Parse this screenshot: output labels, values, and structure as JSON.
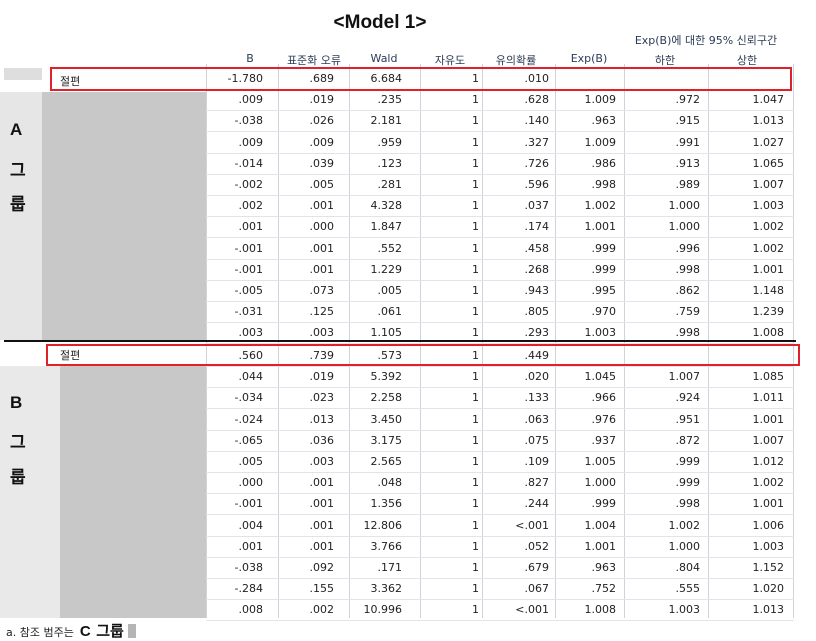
{
  "title": "<Model 1>",
  "headers": {
    "b": "B",
    "se": "표준화 오류",
    "wald": "Wald",
    "df": "자유도",
    "sig": "유의확률",
    "expb": "Exp(B)",
    "ci_group": "Exp(B)에 대한 95% 신뢰구간",
    "lower": "하한",
    "upper": "상한"
  },
  "group_a": {
    "letter": "A",
    "line1": "그",
    "line2": "룹",
    "intercept_label": "절편",
    "rows": [
      [
        "-1.780",
        ".689",
        "6.684",
        "1",
        ".010",
        "",
        "",
        ""
      ],
      [
        ".009",
        ".019",
        ".235",
        "1",
        ".628",
        "1.009",
        ".972",
        "1.047"
      ],
      [
        "-.038",
        ".026",
        "2.181",
        "1",
        ".140",
        ".963",
        ".915",
        "1.013"
      ],
      [
        ".009",
        ".009",
        ".959",
        "1",
        ".327",
        "1.009",
        ".991",
        "1.027"
      ],
      [
        "-.014",
        ".039",
        ".123",
        "1",
        ".726",
        ".986",
        ".913",
        "1.065"
      ],
      [
        "-.002",
        ".005",
        ".281",
        "1",
        ".596",
        ".998",
        ".989",
        "1.007"
      ],
      [
        ".002",
        ".001",
        "4.328",
        "1",
        ".037",
        "1.002",
        "1.000",
        "1.003"
      ],
      [
        ".001",
        ".000",
        "1.847",
        "1",
        ".174",
        "1.001",
        "1.000",
        "1.002"
      ],
      [
        "-.001",
        ".001",
        ".552",
        "1",
        ".458",
        ".999",
        ".996",
        "1.002"
      ],
      [
        "-.001",
        ".001",
        "1.229",
        "1",
        ".268",
        ".999",
        ".998",
        "1.001"
      ],
      [
        "-.005",
        ".073",
        ".005",
        "1",
        ".943",
        ".995",
        ".862",
        "1.148"
      ],
      [
        "-.031",
        ".125",
        ".061",
        "1",
        ".805",
        ".970",
        ".759",
        "1.239"
      ],
      [
        ".003",
        ".003",
        "1.105",
        "1",
        ".293",
        "1.003",
        ".998",
        "1.008"
      ]
    ]
  },
  "group_b": {
    "letter": "B",
    "line1": "그",
    "line2": "룹",
    "intercept_label": "절편",
    "rows": [
      [
        ".560",
        ".739",
        ".573",
        "1",
        ".449",
        "",
        "",
        ""
      ],
      [
        ".044",
        ".019",
        "5.392",
        "1",
        ".020",
        "1.045",
        "1.007",
        "1.085"
      ],
      [
        "-.034",
        ".023",
        "2.258",
        "1",
        ".133",
        ".966",
        ".924",
        "1.011"
      ],
      [
        "-.024",
        ".013",
        "3.450",
        "1",
        ".063",
        ".976",
        ".951",
        "1.001"
      ],
      [
        "-.065",
        ".036",
        "3.175",
        "1",
        ".075",
        ".937",
        ".872",
        "1.007"
      ],
      [
        ".005",
        ".003",
        "2.565",
        "1",
        ".109",
        "1.005",
        ".999",
        "1.012"
      ],
      [
        ".000",
        ".001",
        ".048",
        "1",
        ".827",
        "1.000",
        ".999",
        "1.002"
      ],
      [
        "-.001",
        ".001",
        "1.356",
        "1",
        ".244",
        ".999",
        ".998",
        "1.001"
      ],
      [
        ".004",
        ".001",
        "12.806",
        "1",
        "<.001",
        "1.004",
        "1.002",
        "1.006"
      ],
      [
        ".001",
        ".001",
        "3.766",
        "1",
        ".052",
        "1.001",
        "1.000",
        "1.003"
      ],
      [
        "-.038",
        ".092",
        ".171",
        "1",
        ".679",
        ".963",
        ".804",
        "1.152"
      ],
      [
        "-.284",
        ".155",
        "3.362",
        "1",
        ".067",
        ".752",
        ".555",
        "1.020"
      ],
      [
        ".008",
        ".002",
        "10.996",
        "1",
        "<.001",
        "1.008",
        "1.003",
        "1.013"
      ]
    ]
  },
  "footnote": {
    "prefix": "a. 참조 범주는",
    "letter": "C",
    "word": "그룹"
  },
  "colors": {
    "highlight": "#e0202a",
    "redacted": "#c8c8c8"
  }
}
